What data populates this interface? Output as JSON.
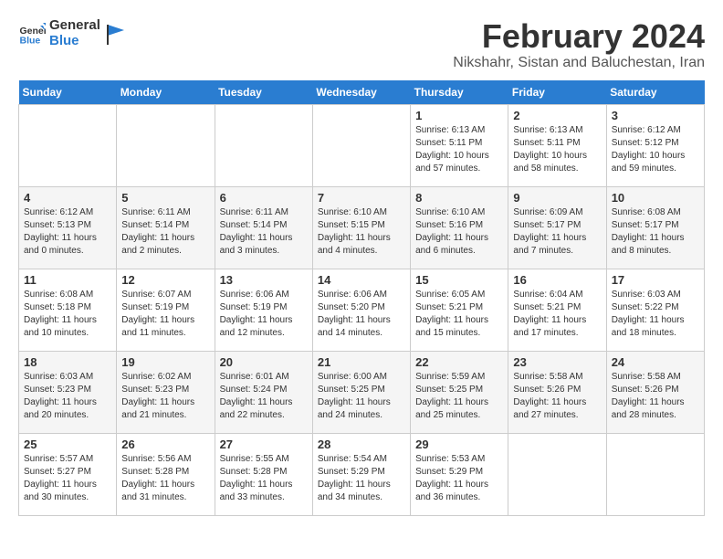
{
  "header": {
    "logo_line1": "General",
    "logo_line2": "Blue",
    "month_year": "February 2024",
    "location": "Nikshahr, Sistan and Baluchestan, Iran"
  },
  "days_of_week": [
    "Sunday",
    "Monday",
    "Tuesday",
    "Wednesday",
    "Thursday",
    "Friday",
    "Saturday"
  ],
  "weeks": [
    [
      {
        "day": "",
        "info": ""
      },
      {
        "day": "",
        "info": ""
      },
      {
        "day": "",
        "info": ""
      },
      {
        "day": "",
        "info": ""
      },
      {
        "day": "1",
        "info": "Sunrise: 6:13 AM\nSunset: 5:11 PM\nDaylight: 10 hours and 57 minutes."
      },
      {
        "day": "2",
        "info": "Sunrise: 6:13 AM\nSunset: 5:11 PM\nDaylight: 10 hours and 58 minutes."
      },
      {
        "day": "3",
        "info": "Sunrise: 6:12 AM\nSunset: 5:12 PM\nDaylight: 10 hours and 59 minutes."
      }
    ],
    [
      {
        "day": "4",
        "info": "Sunrise: 6:12 AM\nSunset: 5:13 PM\nDaylight: 11 hours and 0 minutes."
      },
      {
        "day": "5",
        "info": "Sunrise: 6:11 AM\nSunset: 5:14 PM\nDaylight: 11 hours and 2 minutes."
      },
      {
        "day": "6",
        "info": "Sunrise: 6:11 AM\nSunset: 5:14 PM\nDaylight: 11 hours and 3 minutes."
      },
      {
        "day": "7",
        "info": "Sunrise: 6:10 AM\nSunset: 5:15 PM\nDaylight: 11 hours and 4 minutes."
      },
      {
        "day": "8",
        "info": "Sunrise: 6:10 AM\nSunset: 5:16 PM\nDaylight: 11 hours and 6 minutes."
      },
      {
        "day": "9",
        "info": "Sunrise: 6:09 AM\nSunset: 5:17 PM\nDaylight: 11 hours and 7 minutes."
      },
      {
        "day": "10",
        "info": "Sunrise: 6:08 AM\nSunset: 5:17 PM\nDaylight: 11 hours and 8 minutes."
      }
    ],
    [
      {
        "day": "11",
        "info": "Sunrise: 6:08 AM\nSunset: 5:18 PM\nDaylight: 11 hours and 10 minutes."
      },
      {
        "day": "12",
        "info": "Sunrise: 6:07 AM\nSunset: 5:19 PM\nDaylight: 11 hours and 11 minutes."
      },
      {
        "day": "13",
        "info": "Sunrise: 6:06 AM\nSunset: 5:19 PM\nDaylight: 11 hours and 12 minutes."
      },
      {
        "day": "14",
        "info": "Sunrise: 6:06 AM\nSunset: 5:20 PM\nDaylight: 11 hours and 14 minutes."
      },
      {
        "day": "15",
        "info": "Sunrise: 6:05 AM\nSunset: 5:21 PM\nDaylight: 11 hours and 15 minutes."
      },
      {
        "day": "16",
        "info": "Sunrise: 6:04 AM\nSunset: 5:21 PM\nDaylight: 11 hours and 17 minutes."
      },
      {
        "day": "17",
        "info": "Sunrise: 6:03 AM\nSunset: 5:22 PM\nDaylight: 11 hours and 18 minutes."
      }
    ],
    [
      {
        "day": "18",
        "info": "Sunrise: 6:03 AM\nSunset: 5:23 PM\nDaylight: 11 hours and 20 minutes."
      },
      {
        "day": "19",
        "info": "Sunrise: 6:02 AM\nSunset: 5:23 PM\nDaylight: 11 hours and 21 minutes."
      },
      {
        "day": "20",
        "info": "Sunrise: 6:01 AM\nSunset: 5:24 PM\nDaylight: 11 hours and 22 minutes."
      },
      {
        "day": "21",
        "info": "Sunrise: 6:00 AM\nSunset: 5:25 PM\nDaylight: 11 hours and 24 minutes."
      },
      {
        "day": "22",
        "info": "Sunrise: 5:59 AM\nSunset: 5:25 PM\nDaylight: 11 hours and 25 minutes."
      },
      {
        "day": "23",
        "info": "Sunrise: 5:58 AM\nSunset: 5:26 PM\nDaylight: 11 hours and 27 minutes."
      },
      {
        "day": "24",
        "info": "Sunrise: 5:58 AM\nSunset: 5:26 PM\nDaylight: 11 hours and 28 minutes."
      }
    ],
    [
      {
        "day": "25",
        "info": "Sunrise: 5:57 AM\nSunset: 5:27 PM\nDaylight: 11 hours and 30 minutes."
      },
      {
        "day": "26",
        "info": "Sunrise: 5:56 AM\nSunset: 5:28 PM\nDaylight: 11 hours and 31 minutes."
      },
      {
        "day": "27",
        "info": "Sunrise: 5:55 AM\nSunset: 5:28 PM\nDaylight: 11 hours and 33 minutes."
      },
      {
        "day": "28",
        "info": "Sunrise: 5:54 AM\nSunset: 5:29 PM\nDaylight: 11 hours and 34 minutes."
      },
      {
        "day": "29",
        "info": "Sunrise: 5:53 AM\nSunset: 5:29 PM\nDaylight: 11 hours and 36 minutes."
      },
      {
        "day": "",
        "info": ""
      },
      {
        "day": "",
        "info": ""
      }
    ]
  ]
}
